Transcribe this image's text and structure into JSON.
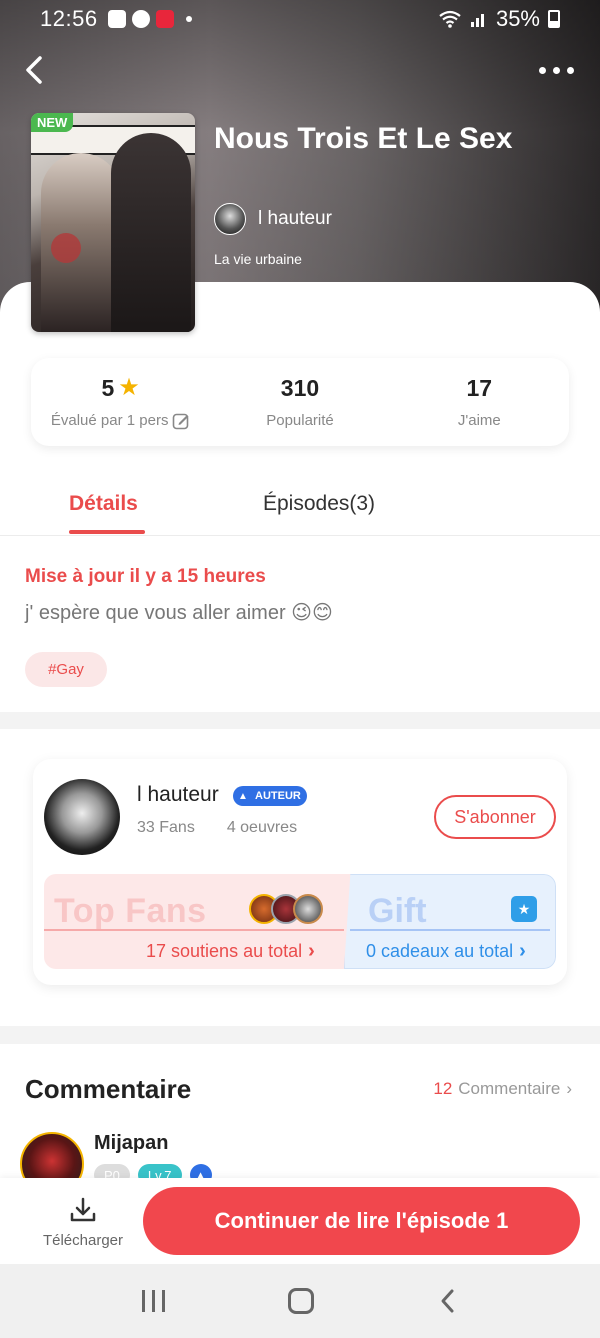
{
  "status_bar": {
    "time": "12:56",
    "battery": "35%"
  },
  "comic": {
    "title": "Nous Trois Et Le Sex",
    "badge": "NEW",
    "author": "l hauteur",
    "genre": "La vie urbaine"
  },
  "stats": {
    "rating_value": "5",
    "rating_label": "Évalué par 1 pers",
    "popularity_value": "310",
    "popularity_label": "Popularité",
    "likes_value": "17",
    "likes_label": "J'aime"
  },
  "tabs": {
    "details": "Détails",
    "episodes": "Épisodes(3)"
  },
  "details": {
    "update_text": "Mise à jour il y a 15 heures",
    "description": "j' espère que vous aller aimer 😉😊",
    "tag": "#Gay"
  },
  "author_card": {
    "name": "l hauteur",
    "badge": "AUTEUR",
    "fans": "33 Fans",
    "works": "4 oeuvres",
    "subscribe_label": "S'abonner",
    "top_fans_title": "Top Fans",
    "top_fans_total": "17 soutiens au total",
    "gift_title": "Gift",
    "gift_total": "0 cadeaux au total"
  },
  "comments": {
    "title": "Commentaire",
    "count": "12",
    "link_label": "Commentaire",
    "first_user": "Mijapan",
    "first_badges": [
      "P0",
      "Lv.7"
    ]
  },
  "bottom_bar": {
    "download_label": "Télécharger",
    "continue_label": "Continuer de lire l'épisode 1"
  },
  "colors": {
    "accent": "#ea4c4c",
    "primary_button": "#f1474d",
    "gift_blue": "#2f8fe8",
    "tag_bg": "#fbe7e7"
  }
}
